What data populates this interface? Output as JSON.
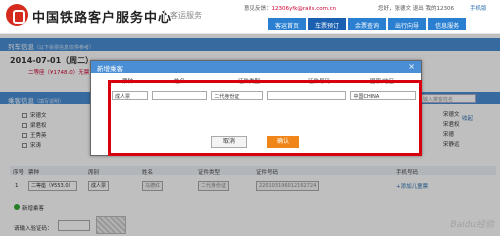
{
  "header": {
    "brand": "中国铁路客户服务中心",
    "subtitle": "客运服务",
    "feedback_prefix": "意见反馈：",
    "feedback_email": "12306yfk@rails.com.cn",
    "welcome": "您好，张德文  退出",
    "mine": "我的12306",
    "mobile": "手机版",
    "nav": [
      "客运首页",
      "车票预订",
      "余票查询",
      "出行向导",
      "信息服务"
    ]
  },
  "train_bar": {
    "title": "列车信息",
    "hint": "（以下余票信息仅供参考）"
  },
  "train": {
    "date": "2014-07-01（周二）",
    "price": "二等座（¥1748.0）无票"
  },
  "passenger_bar": {
    "title": "乘客信息",
    "hint": "（填写说明）"
  },
  "search_placeholder": "输入乘客姓名",
  "passenger_list": [
    "宋德文",
    "梁君权",
    "王秀英",
    "宋涛"
  ],
  "right_list": [
    "宋德文",
    "宋君权",
    "宋德",
    "宋静远"
  ],
  "collapse_label": "收起",
  "table": {
    "headers": [
      "序号",
      "票种",
      "席别",
      "姓名",
      "证件类型",
      "证件号码",
      "手机号码"
    ],
    "row": {
      "index": "1",
      "seat": "二等座（¥553.0）",
      "ticket_type": "成人票",
      "name": "马德红",
      "id_type": "二代身份证",
      "id_number": "220103196012162724",
      "action": "+添加儿童票"
    }
  },
  "add_passenger": "新增乘客",
  "captcha_label": "请输入验证码：",
  "modal": {
    "title": "新增乘客",
    "close": "×",
    "columns": [
      "票种",
      "姓名",
      "证件类型",
      "证件号码",
      "国家/地区"
    ],
    "row": {
      "ticket_type": "成人票",
      "name": "",
      "id_type": "二代身份证",
      "id_number": "",
      "country": "中国CHINA"
    },
    "cancel": "取消",
    "confirm": "确认"
  },
  "watermark": "Baidu经验"
}
